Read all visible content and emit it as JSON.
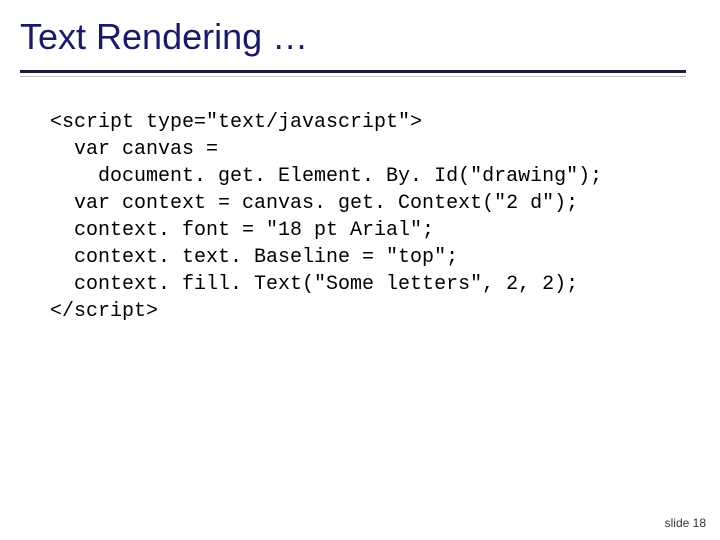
{
  "title": "Text Rendering …",
  "code": {
    "l1": "<script type=\"text/javascript\">",
    "l2": "  var canvas =",
    "l3": "    document. get. Element. By. Id(\"drawing\");",
    "l4": "  var context = canvas. get. Context(\"2 d\");",
    "l5": "  context. font = \"18 pt Arial\";",
    "l6": "  context. text. Baseline = \"top\";",
    "l7": "  context. fill. Text(\"Some letters\", 2, 2);",
    "l8": "</script>"
  },
  "footer": "slide 18"
}
